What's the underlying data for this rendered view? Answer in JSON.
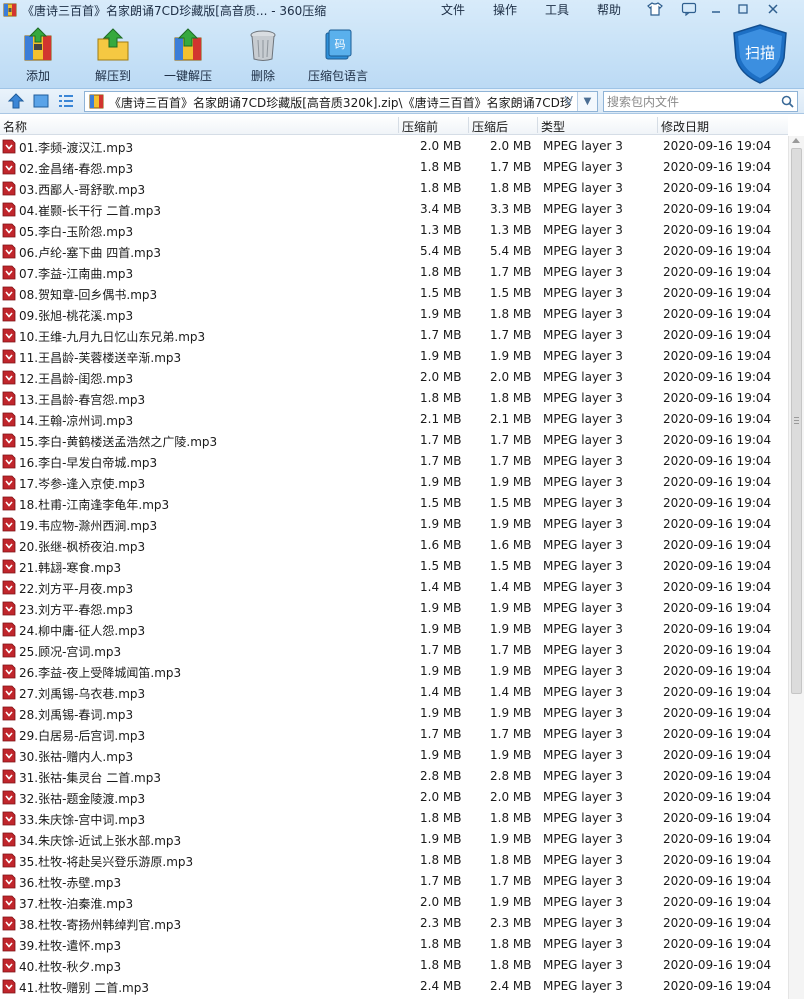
{
  "window": {
    "title": "《唐诗三百首》名家朗诵7CD珍藏版[高音质... - 360压缩"
  },
  "menu": [
    "文件",
    "操作",
    "工具",
    "帮助"
  ],
  "toolbar": {
    "buttons": [
      {
        "label": "添加",
        "icon": "add-archive-icon"
      },
      {
        "label": "解压到",
        "icon": "extract-to-icon"
      },
      {
        "label": "一键解压",
        "icon": "one-click-extract-icon"
      },
      {
        "label": "删除",
        "icon": "trash-icon"
      },
      {
        "label": "压缩包语言",
        "icon": "archive-language-icon"
      }
    ],
    "scan_label": "扫描"
  },
  "address": {
    "path": "《唐诗三百首》名家朗诵7CD珍藏版[高音质320k].zip\\《唐诗三百首》名家朗诵7CD珍",
    "search_placeholder": "搜索包内文件"
  },
  "columns": {
    "name": "名称",
    "before": "压缩前",
    "after": "压缩后",
    "type": "类型",
    "date": "修改日期"
  },
  "colors": {
    "accent": "#1d6fc4",
    "file_icon": "#c0262c",
    "header_bg": "#c8e2f7"
  },
  "files": [
    {
      "name": "01.李频-渡汉江.mp3",
      "before": "2.0 MB",
      "after": "2.0 MB",
      "type": "MPEG layer 3",
      "date": "2020-09-16 19:04"
    },
    {
      "name": "02.金昌绪-春怨.mp3",
      "before": "1.8 MB",
      "after": "1.7 MB",
      "type": "MPEG layer 3",
      "date": "2020-09-16 19:04"
    },
    {
      "name": "03.西鄙人-哥舒歌.mp3",
      "before": "1.8 MB",
      "after": "1.8 MB",
      "type": "MPEG layer 3",
      "date": "2020-09-16 19:04"
    },
    {
      "name": "04.崔颢-长干行 二首.mp3",
      "before": "3.4 MB",
      "after": "3.3 MB",
      "type": "MPEG layer 3",
      "date": "2020-09-16 19:04"
    },
    {
      "name": "05.李白-玉阶怨.mp3",
      "before": "1.3 MB",
      "after": "1.3 MB",
      "type": "MPEG layer 3",
      "date": "2020-09-16 19:04"
    },
    {
      "name": "06.卢纶-塞下曲 四首.mp3",
      "before": "5.4 MB",
      "after": "5.4 MB",
      "type": "MPEG layer 3",
      "date": "2020-09-16 19:04"
    },
    {
      "name": "07.李益-江南曲.mp3",
      "before": "1.8 MB",
      "after": "1.7 MB",
      "type": "MPEG layer 3",
      "date": "2020-09-16 19:04"
    },
    {
      "name": "08.贺知章-回乡偶书.mp3",
      "before": "1.5 MB",
      "after": "1.5 MB",
      "type": "MPEG layer 3",
      "date": "2020-09-16 19:04"
    },
    {
      "name": "09.张旭-桃花溪.mp3",
      "before": "1.9 MB",
      "after": "1.8 MB",
      "type": "MPEG layer 3",
      "date": "2020-09-16 19:04"
    },
    {
      "name": "10.王维-九月九日忆山东兄弟.mp3",
      "before": "1.7 MB",
      "after": "1.7 MB",
      "type": "MPEG layer 3",
      "date": "2020-09-16 19:04"
    },
    {
      "name": "11.王昌龄-芙蓉楼送辛渐.mp3",
      "before": "1.9 MB",
      "after": "1.9 MB",
      "type": "MPEG layer 3",
      "date": "2020-09-16 19:04"
    },
    {
      "name": "12.王昌龄-闺怨.mp3",
      "before": "2.0 MB",
      "after": "2.0 MB",
      "type": "MPEG layer 3",
      "date": "2020-09-16 19:04"
    },
    {
      "name": "13.王昌龄-春宫怨.mp3",
      "before": "1.8 MB",
      "after": "1.8 MB",
      "type": "MPEG layer 3",
      "date": "2020-09-16 19:04"
    },
    {
      "name": "14.王翰-凉州词.mp3",
      "before": "2.1 MB",
      "after": "2.1 MB",
      "type": "MPEG layer 3",
      "date": "2020-09-16 19:04"
    },
    {
      "name": "15.李白-黄鹤楼送孟浩然之广陵.mp3",
      "before": "1.7 MB",
      "after": "1.7 MB",
      "type": "MPEG layer 3",
      "date": "2020-09-16 19:04"
    },
    {
      "name": "16.李白-早发白帝城.mp3",
      "before": "1.7 MB",
      "after": "1.7 MB",
      "type": "MPEG layer 3",
      "date": "2020-09-16 19:04"
    },
    {
      "name": "17.岑参-逢入京使.mp3",
      "before": "1.9 MB",
      "after": "1.9 MB",
      "type": "MPEG layer 3",
      "date": "2020-09-16 19:04"
    },
    {
      "name": "18.杜甫-江南逢李龟年.mp3",
      "before": "1.5 MB",
      "after": "1.5 MB",
      "type": "MPEG layer 3",
      "date": "2020-09-16 19:04"
    },
    {
      "name": "19.韦应物-滁州西涧.mp3",
      "before": "1.9 MB",
      "after": "1.9 MB",
      "type": "MPEG layer 3",
      "date": "2020-09-16 19:04"
    },
    {
      "name": "20.张继-枫桥夜泊.mp3",
      "before": "1.6 MB",
      "after": "1.6 MB",
      "type": "MPEG layer 3",
      "date": "2020-09-16 19:04"
    },
    {
      "name": "21.韩翃-寒食.mp3",
      "before": "1.5 MB",
      "after": "1.5 MB",
      "type": "MPEG layer 3",
      "date": "2020-09-16 19:04"
    },
    {
      "name": "22.刘方平-月夜.mp3",
      "before": "1.4 MB",
      "after": "1.4 MB",
      "type": "MPEG layer 3",
      "date": "2020-09-16 19:04"
    },
    {
      "name": "23.刘方平-春怨.mp3",
      "before": "1.9 MB",
      "after": "1.9 MB",
      "type": "MPEG layer 3",
      "date": "2020-09-16 19:04"
    },
    {
      "name": "24.柳中庸-征人怨.mp3",
      "before": "1.9 MB",
      "after": "1.9 MB",
      "type": "MPEG layer 3",
      "date": "2020-09-16 19:04"
    },
    {
      "name": "25.顾况-宫词.mp3",
      "before": "1.7 MB",
      "after": "1.7 MB",
      "type": "MPEG layer 3",
      "date": "2020-09-16 19:04"
    },
    {
      "name": "26.李益-夜上受降城闻笛.mp3",
      "before": "1.9 MB",
      "after": "1.9 MB",
      "type": "MPEG layer 3",
      "date": "2020-09-16 19:04"
    },
    {
      "name": "27.刘禹锡-乌衣巷.mp3",
      "before": "1.4 MB",
      "after": "1.4 MB",
      "type": "MPEG layer 3",
      "date": "2020-09-16 19:04"
    },
    {
      "name": "28.刘禹锡-春词.mp3",
      "before": "1.9 MB",
      "after": "1.9 MB",
      "type": "MPEG layer 3",
      "date": "2020-09-16 19:04"
    },
    {
      "name": "29.白居易-后宫词.mp3",
      "before": "1.7 MB",
      "after": "1.7 MB",
      "type": "MPEG layer 3",
      "date": "2020-09-16 19:04"
    },
    {
      "name": "30.张祜-赠内人.mp3",
      "before": "1.9 MB",
      "after": "1.9 MB",
      "type": "MPEG layer 3",
      "date": "2020-09-16 19:04"
    },
    {
      "name": "31.张祜-集灵台 二首.mp3",
      "before": "2.8 MB",
      "after": "2.8 MB",
      "type": "MPEG layer 3",
      "date": "2020-09-16 19:04"
    },
    {
      "name": "32.张祜-题金陵渡.mp3",
      "before": "2.0 MB",
      "after": "2.0 MB",
      "type": "MPEG layer 3",
      "date": "2020-09-16 19:04"
    },
    {
      "name": "33.朱庆馀-宫中词.mp3",
      "before": "1.8 MB",
      "after": "1.8 MB",
      "type": "MPEG layer 3",
      "date": "2020-09-16 19:04"
    },
    {
      "name": "34.朱庆馀-近试上张水部.mp3",
      "before": "1.9 MB",
      "after": "1.9 MB",
      "type": "MPEG layer 3",
      "date": "2020-09-16 19:04"
    },
    {
      "name": "35.杜牧-将赴吴兴登乐游原.mp3",
      "before": "1.8 MB",
      "after": "1.8 MB",
      "type": "MPEG layer 3",
      "date": "2020-09-16 19:04"
    },
    {
      "name": "36.杜牧-赤壁.mp3",
      "before": "1.7 MB",
      "after": "1.7 MB",
      "type": "MPEG layer 3",
      "date": "2020-09-16 19:04"
    },
    {
      "name": "37.杜牧-泊秦淮.mp3",
      "before": "2.0 MB",
      "after": "1.9 MB",
      "type": "MPEG layer 3",
      "date": "2020-09-16 19:04"
    },
    {
      "name": "38.杜牧-寄扬州韩绰判官.mp3",
      "before": "2.3 MB",
      "after": "2.3 MB",
      "type": "MPEG layer 3",
      "date": "2020-09-16 19:04"
    },
    {
      "name": "39.杜牧-遣怀.mp3",
      "before": "1.8 MB",
      "after": "1.8 MB",
      "type": "MPEG layer 3",
      "date": "2020-09-16 19:04"
    },
    {
      "name": "40.杜牧-秋夕.mp3",
      "before": "1.8 MB",
      "after": "1.8 MB",
      "type": "MPEG layer 3",
      "date": "2020-09-16 19:04"
    },
    {
      "name": "41.杜牧-赠别 二首.mp3",
      "before": "2.4 MB",
      "after": "2.4 MB",
      "type": "MPEG layer 3",
      "date": "2020-09-16 19:04"
    }
  ]
}
